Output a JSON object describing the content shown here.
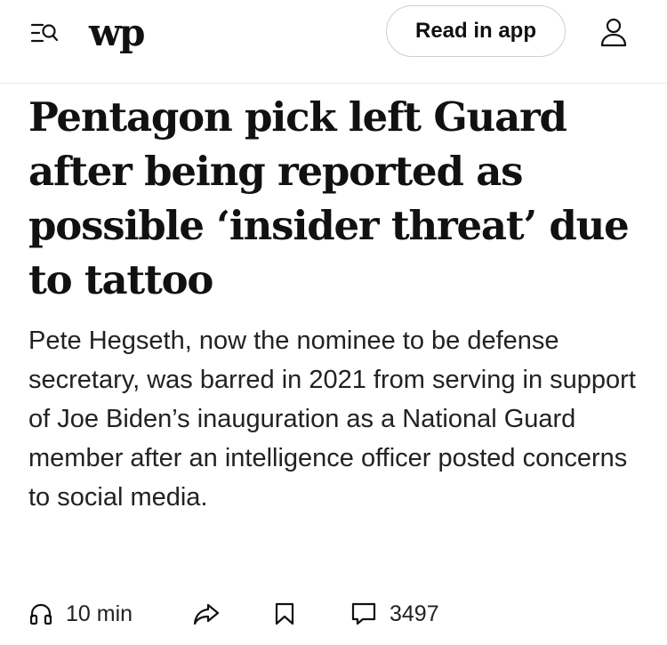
{
  "header": {
    "logo_text": "wp",
    "read_in_app_label": "Read in app",
    "icons": {
      "menu_search": "menu-search-icon",
      "account": "account-icon"
    }
  },
  "article": {
    "headline": "Pentagon pick left Guard after being reported as possible ‘insider threat’ due to tattoo",
    "dek": "Pete Hegseth, now the nominee to be defense secretary, was barred in 2021 from serving in support of Joe Biden’s inauguration as a National Guard member after an intelligence officer posted concerns to social media."
  },
  "actions": {
    "listen_label": "10 min",
    "comments_count": "3497",
    "icons": {
      "listen": "headphones-icon",
      "share": "share-icon",
      "save": "bookmark-icon",
      "comments": "comment-icon"
    }
  }
}
